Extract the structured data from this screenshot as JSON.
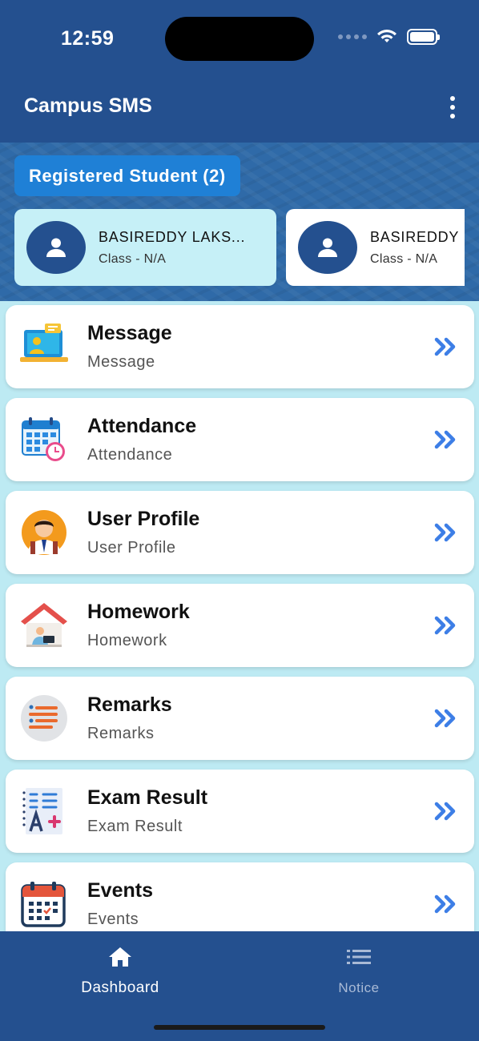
{
  "status_bar": {
    "time": "12:59"
  },
  "app_bar": {
    "title": "Campus SMS"
  },
  "students": {
    "chip_label": "Registered Student (2)",
    "cards": [
      {
        "name": "BASIREDDY LAKS...",
        "class": "Class - N/A"
      },
      {
        "name": "BASIREDDY LAKS...",
        "class": "Class - N/A"
      }
    ]
  },
  "menu": [
    {
      "title": "Message",
      "subtitle": "Message"
    },
    {
      "title": "Attendance",
      "subtitle": "Attendance"
    },
    {
      "title": "User Profile",
      "subtitle": "User Profile"
    },
    {
      "title": "Homework",
      "subtitle": "Homework"
    },
    {
      "title": "Remarks",
      "subtitle": "Remarks"
    },
    {
      "title": "Exam Result",
      "subtitle": "Exam Result"
    },
    {
      "title": "Events",
      "subtitle": "Events"
    }
  ],
  "bottom_nav": [
    {
      "label": "Dashboard",
      "icon": "home-icon",
      "active": true
    },
    {
      "label": "Notice",
      "icon": "list-icon",
      "active": false
    }
  ],
  "colors": {
    "primary": "#24508f",
    "chip": "#1f80d6",
    "selected_card": "#c6f0f7",
    "page_bg": "#bdeaf3",
    "arrow": "#3d7ee6"
  }
}
